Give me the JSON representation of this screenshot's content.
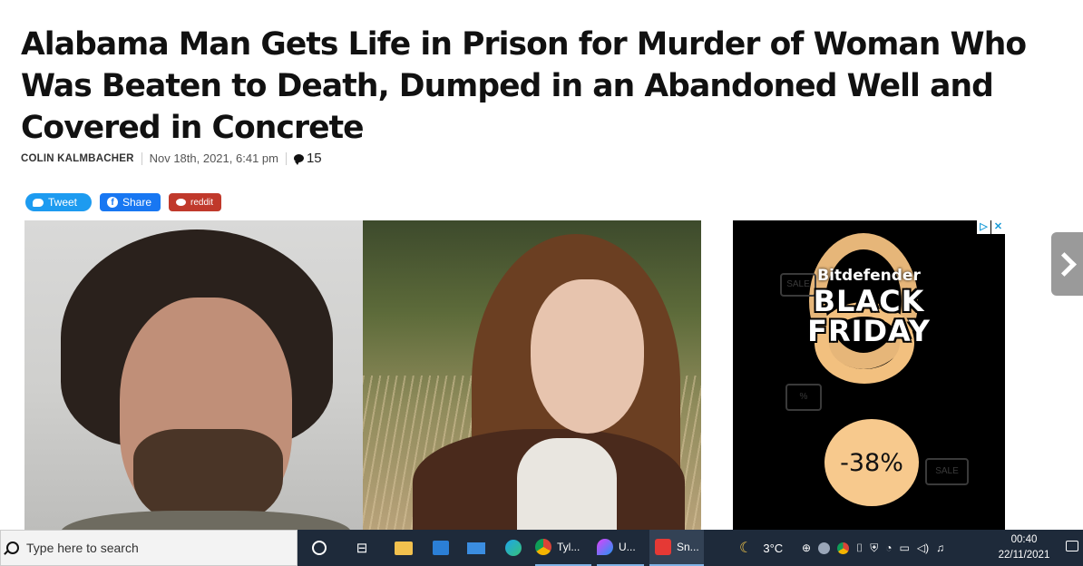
{
  "article": {
    "headline": "Alabama Man Gets Life in Prison for Murder of Woman Who Was Beaten to Death, Dumped in an Abandoned Well and Covered in Concrete",
    "author": "COLIN KALMBACHER",
    "date": "Nov 18th, 2021, 6:41 pm",
    "comment_count": "15"
  },
  "share": {
    "tweet_label": "Tweet",
    "facebook_label": "Share",
    "reddit_label": "reddit"
  },
  "ad": {
    "brand": "Bitdefender",
    "line1": "BLACK",
    "line2": "FRIDAY",
    "discount": "-38%",
    "doodle_sale": "SALE",
    "doodle_pct": "%",
    "adchoices_icon": "ad-choices-icon",
    "close_icon": "close-icon",
    "colors": {
      "background": "#000000",
      "accent": "#f2c07f"
    }
  },
  "taskbar": {
    "search_placeholder": "Type here to search",
    "apps": [
      {
        "label": "Tyl...",
        "icon": "chrome-icon"
      },
      {
        "label": "U...",
        "icon": "paint-icon"
      },
      {
        "label": "Sn...",
        "icon": "snipping-tool-icon"
      }
    ],
    "weather": "3°C",
    "time": "00:40",
    "date": "22/11/2021"
  }
}
